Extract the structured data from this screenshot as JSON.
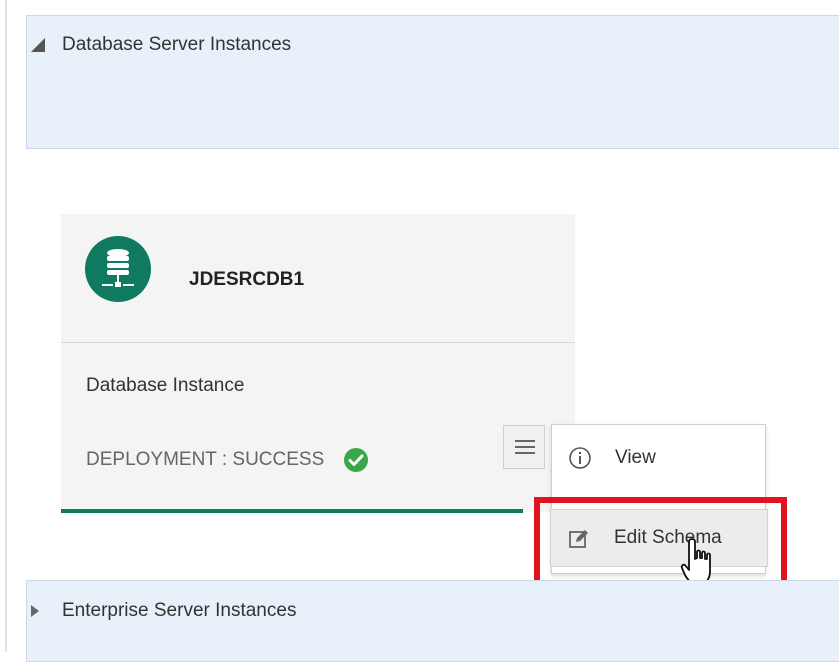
{
  "sections": {
    "database": {
      "title": "Database Server Instances",
      "expanded": true
    },
    "enterprise": {
      "title": "Enterprise Server Instances",
      "expanded": false
    }
  },
  "card": {
    "icon": "database-server-icon",
    "name": "JDESRCDB1",
    "type": "Database Instance",
    "status": "DEPLOYMENT : SUCCESS",
    "status_icon": "check-circle-icon",
    "accent_color": "#0f7a5f"
  },
  "menu": {
    "button_icon": "hamburger-menu-icon",
    "items": [
      {
        "label": "View",
        "icon": "info-icon"
      },
      {
        "label": "Edit Schema",
        "icon": "edit-icon"
      }
    ]
  },
  "colors": {
    "section_bg": "#e8f0f9",
    "success": "#3aa64a",
    "highlight": "#e0141e"
  }
}
